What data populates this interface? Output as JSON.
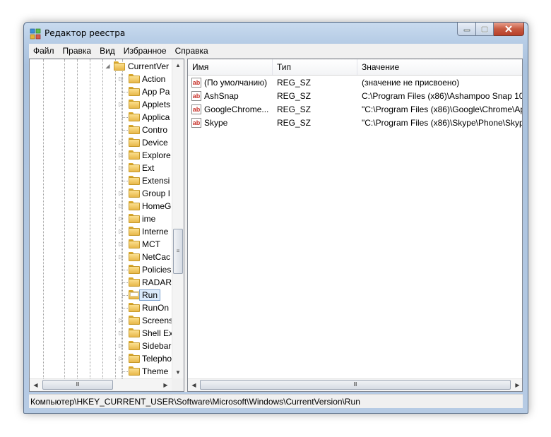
{
  "window": {
    "title": "Редактор реестра"
  },
  "menu": [
    "Файл",
    "Правка",
    "Вид",
    "Избранное",
    "Справка"
  ],
  "tree": {
    "parent": {
      "label": "CurrentVer"
    },
    "items": [
      {
        "label": "Action",
        "expandable": true
      },
      {
        "label": "App Pa",
        "expandable": false
      },
      {
        "label": "Applets",
        "expandable": true
      },
      {
        "label": "Applica",
        "expandable": false
      },
      {
        "label": "Contro",
        "expandable": false
      },
      {
        "label": "Device",
        "expandable": true
      },
      {
        "label": "Explore",
        "expandable": true
      },
      {
        "label": "Ext",
        "expandable": true
      },
      {
        "label": "Extensi",
        "expandable": false
      },
      {
        "label": "Group I",
        "expandable": true
      },
      {
        "label": "HomeG",
        "expandable": true
      },
      {
        "label": "ime",
        "expandable": true
      },
      {
        "label": "Interne",
        "expandable": true
      },
      {
        "label": "MCT",
        "expandable": true
      },
      {
        "label": "NetCac",
        "expandable": true
      },
      {
        "label": "Policies",
        "expandable": false
      },
      {
        "label": "RADAR",
        "expandable": false
      },
      {
        "label": "Run",
        "expandable": false,
        "selected": true
      },
      {
        "label": "RunOn",
        "expandable": false
      },
      {
        "label": "Screens",
        "expandable": true
      },
      {
        "label": "Shell Ex",
        "expandable": true
      },
      {
        "label": "Sidebar",
        "expandable": true
      },
      {
        "label": "Telepho",
        "expandable": true
      },
      {
        "label": "Theme",
        "expandable": false
      }
    ]
  },
  "list": {
    "columns": [
      "Имя",
      "Тип",
      "Значение"
    ],
    "rows": [
      {
        "name": "(По умолчанию)",
        "type": "REG_SZ",
        "value": "(значение не присвоено)"
      },
      {
        "name": "AshSnap",
        "type": "REG_SZ",
        "value": "C:\\Program Files (x86)\\Ashampoo Snap 10\\"
      },
      {
        "name": "GoogleChrome...",
        "type": "REG_SZ",
        "value": "\"C:\\Program Files (x86)\\Google\\Chrome\\Ap"
      },
      {
        "name": "Skype",
        "type": "REG_SZ",
        "value": "\"C:\\Program Files (x86)\\Skype\\Phone\\Skype"
      }
    ]
  },
  "icons": {
    "string_value": "ab",
    "folder": "folder-icon",
    "app": "registry-editor-icon"
  },
  "statusbar": {
    "path": "Компьютер\\HKEY_CURRENT_USER\\Software\\Microsoft\\Windows\\CurrentVersion\\Run"
  },
  "colors": {
    "selection_bg": "#dcebfc",
    "selection_border": "#7da2ce",
    "close_button": "#c75a41",
    "string_icon_text": "#c8322a"
  }
}
